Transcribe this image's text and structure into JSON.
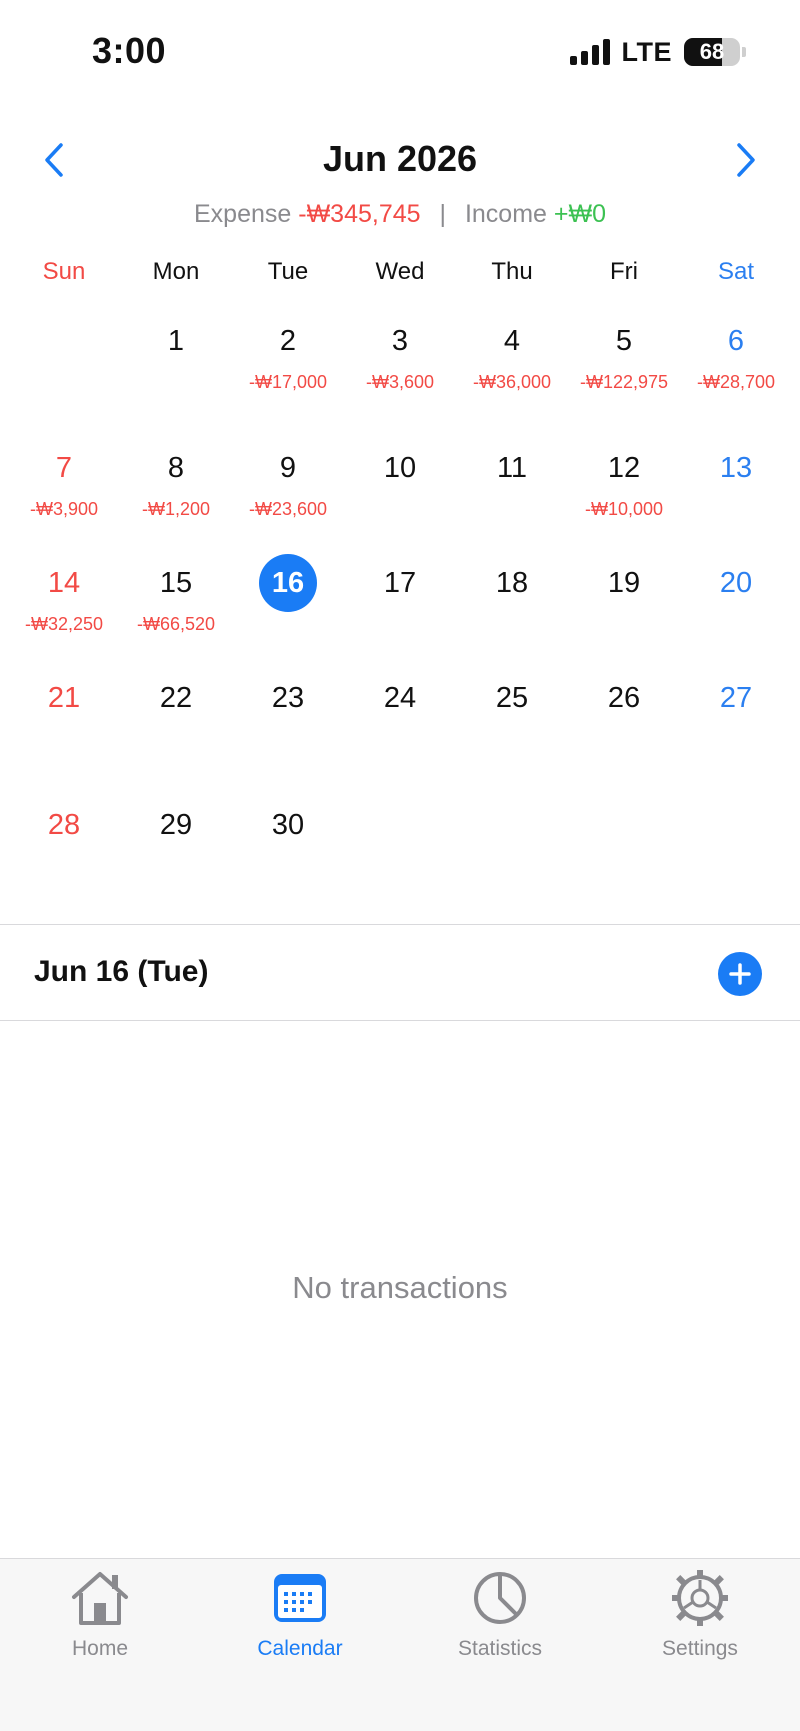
{
  "status_bar": {
    "time": "3:00",
    "network": "LTE",
    "battery": "68",
    "battery_level": 0.68
  },
  "header": {
    "month_title": "Jun 2026",
    "prev_icon": "chevron-left-icon",
    "next_icon": "chevron-right-icon"
  },
  "summary": {
    "expense_label": "Expense",
    "expense_value": "-₩345,745",
    "separator": "|",
    "income_label": "Income",
    "income_value": "+₩0"
  },
  "weekdays": [
    "Sun",
    "Mon",
    "Tue",
    "Wed",
    "Thu",
    "Fri",
    "Sat"
  ],
  "calendar": {
    "today": "16",
    "weeks": [
      [
        {
          "day": "",
          "amount": ""
        },
        {
          "day": "1",
          "amount": ""
        },
        {
          "day": "2",
          "amount": "-₩17,000"
        },
        {
          "day": "3",
          "amount": "-₩3,600"
        },
        {
          "day": "4",
          "amount": "-₩36,000"
        },
        {
          "day": "5",
          "amount": "-₩122,975"
        },
        {
          "day": "6",
          "amount": "-₩28,700"
        }
      ],
      [
        {
          "day": "7",
          "amount": "-₩3,900"
        },
        {
          "day": "8",
          "amount": "-₩1,200"
        },
        {
          "day": "9",
          "amount": "-₩23,600"
        },
        {
          "day": "10",
          "amount": ""
        },
        {
          "day": "11",
          "amount": ""
        },
        {
          "day": "12",
          "amount": "-₩10,000"
        },
        {
          "day": "13",
          "amount": ""
        }
      ],
      [
        {
          "day": "14",
          "amount": "-₩32,250"
        },
        {
          "day": "15",
          "amount": "-₩66,520"
        },
        {
          "day": "16",
          "amount": ""
        },
        {
          "day": "17",
          "amount": ""
        },
        {
          "day": "18",
          "amount": ""
        },
        {
          "day": "19",
          "amount": ""
        },
        {
          "day": "20",
          "amount": ""
        }
      ],
      [
        {
          "day": "21",
          "amount": ""
        },
        {
          "day": "22",
          "amount": ""
        },
        {
          "day": "23",
          "amount": ""
        },
        {
          "day": "24",
          "amount": ""
        },
        {
          "day": "25",
          "amount": ""
        },
        {
          "day": "26",
          "amount": ""
        },
        {
          "day": "27",
          "amount": ""
        }
      ],
      [
        {
          "day": "28",
          "amount": ""
        },
        {
          "day": "29",
          "amount": ""
        },
        {
          "day": "30",
          "amount": ""
        },
        {
          "day": "",
          "amount": ""
        },
        {
          "day": "",
          "amount": ""
        },
        {
          "day": "",
          "amount": ""
        },
        {
          "day": "",
          "amount": ""
        }
      ]
    ]
  },
  "selected_day": {
    "title": "Jun 16 (Tue)",
    "add_icon": "plus-icon",
    "empty_text": "No transactions"
  },
  "tabs": [
    {
      "label": "Home",
      "icon": "home-icon",
      "active": false
    },
    {
      "label": "Calendar",
      "icon": "calendar-icon",
      "active": true
    },
    {
      "label": "Statistics",
      "icon": "pie-chart-icon",
      "active": false
    },
    {
      "label": "Settings",
      "icon": "gear-icon",
      "active": false
    }
  ],
  "colors": {
    "accent": "#1a7cf5",
    "expense": "#f24a45",
    "income": "#3cc152",
    "sunday": "#f24a45",
    "saturday": "#2b7ff0",
    "muted": "#8a8a8e"
  }
}
